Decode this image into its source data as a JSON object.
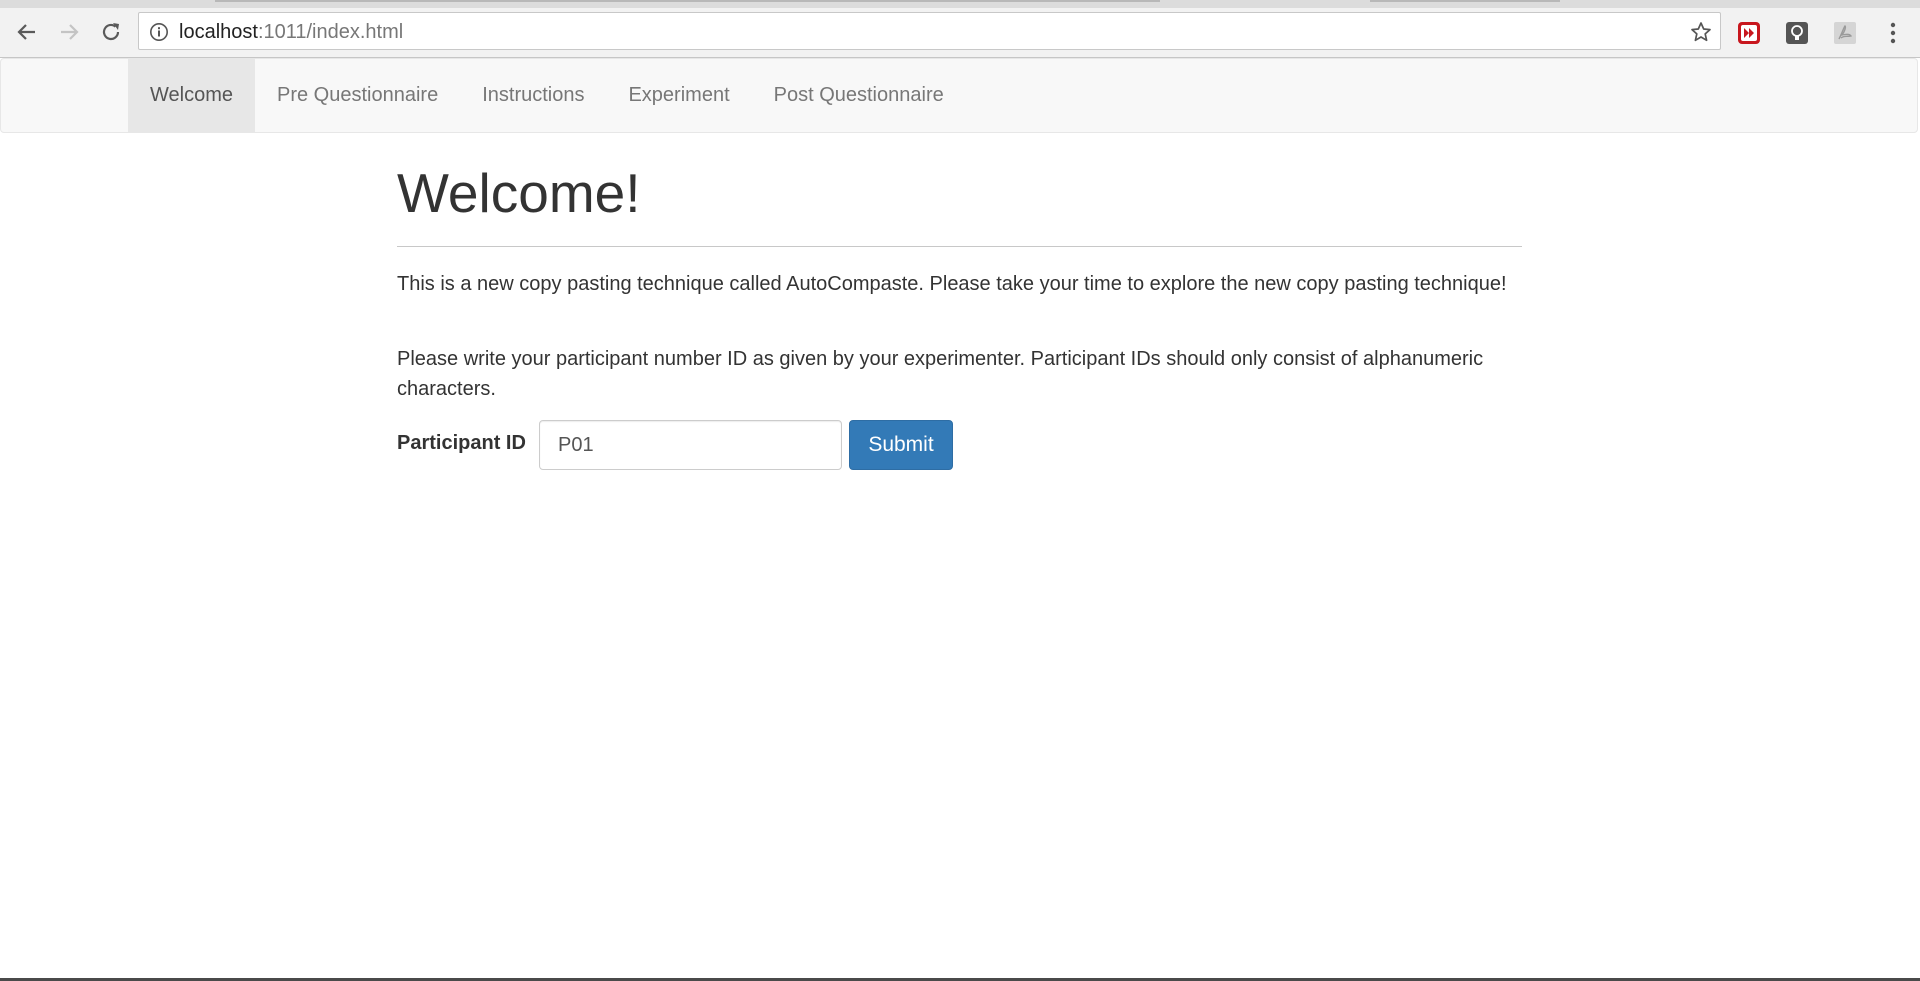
{
  "browser": {
    "url_host": "localhost",
    "url_rest": ":1011/index.html",
    "icons": [
      "back-arrow-icon",
      "forward-arrow-icon",
      "reload-icon",
      "info-icon",
      "star-icon",
      "extension-red-icon",
      "extension-bulb-icon",
      "extension-pdf-icon",
      "menu-dots-icon"
    ]
  },
  "navbar": {
    "items": [
      {
        "label": "Welcome",
        "active": true
      },
      {
        "label": "Pre Questionnaire"
      },
      {
        "label": "Instructions"
      },
      {
        "label": "Experiment"
      },
      {
        "label": "Post Questionnaire"
      }
    ]
  },
  "main": {
    "title": "Welcome!",
    "paragraph1": "This is a new copy pasting technique called AutoCompaste. Please take your time to explore the new copy pasting technique!",
    "paragraph2": "Please write your participant number ID as given by your experimenter. Participant IDs should only consist of alphanumeric characters.",
    "form": {
      "label": "Participant ID",
      "value": "P01",
      "submit_label": "Submit"
    }
  },
  "colors": {
    "primary_button": "#337ab7",
    "navbar_bg": "#f8f8f8",
    "active_nav_bg": "#e7e7e7"
  }
}
